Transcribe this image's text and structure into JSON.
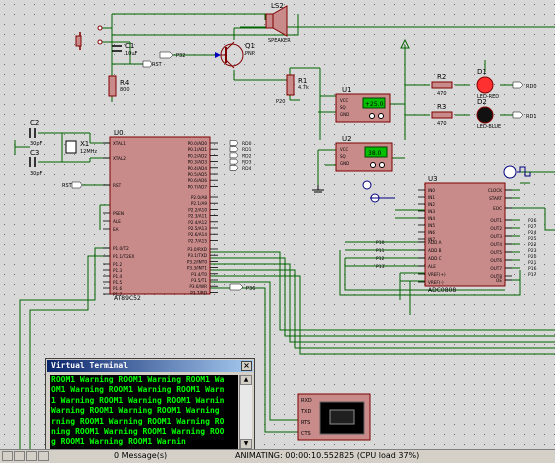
{
  "colors": {
    "background": "#d8d8d8",
    "grid_dot": "#6a6a6a",
    "wire": "#006400",
    "component_fill": "#c98a8a",
    "component_stroke": "#800000",
    "label": "#000080",
    "terminal_text": "#00ff00",
    "led_red": "#ff3030",
    "display_green": "#00c000"
  },
  "components": {
    "ls2": {
      "ref": "LS2",
      "value": "SPEAKER"
    },
    "q1": {
      "ref": "Q1",
      "value": "PNP"
    },
    "c1": {
      "ref": "C1",
      "value": "10uF"
    },
    "r4": {
      "ref": "R4",
      "value": "800"
    },
    "r1": {
      "ref": "R1",
      "value": "4.7k"
    },
    "r2": {
      "ref": "R2",
      "value": "470"
    },
    "r3": {
      "ref": "R3",
      "value": "470"
    },
    "d1": {
      "ref": "D1",
      "value": "LED-RED"
    },
    "d2": {
      "ref": "D2",
      "value": "LED-BLUE"
    },
    "c2": {
      "ref": "C2",
      "value": "30pF"
    },
    "c3": {
      "ref": "C3",
      "value": "30pF"
    },
    "x1": {
      "ref": "X1",
      "value": "12MHz"
    },
    "u0": {
      "ref": "U0",
      "value": "AT89C52"
    },
    "u1": {
      "ref": "U1",
      "value": "DHT11",
      "display": "+25.0"
    },
    "u2": {
      "ref": "U2",
      "value": "DHT11",
      "display": "38.0"
    },
    "u3": {
      "ref": "U3",
      "value": "ADC0808"
    }
  },
  "u0_pins_left": [
    "XTAL1",
    "XTAL2",
    "RST",
    "PSEN",
    "ALE",
    "EA",
    "P1.0/T2",
    "P1.1/T2EX",
    "P1.2",
    "P1.3",
    "P1.4",
    "P1.5",
    "P1.6",
    "P1.7"
  ],
  "u0_pins_right_top": [
    "P0.0/AD0",
    "P0.1/AD1",
    "P0.2/AD2",
    "P0.3/AD3",
    "P0.4/AD4",
    "P0.5/AD5",
    "P0.6/AD6",
    "P0.7/AD7"
  ],
  "u0_pins_right_mid": [
    "P2.0/A8",
    "P2.1/A9",
    "P2.2/A10",
    "P2.3/A11",
    "P2.4/A12",
    "P2.5/A13",
    "P2.6/A14",
    "P2.7/A15"
  ],
  "u0_pins_right_bot": [
    "P3.0/RXD",
    "P3.1/TXD",
    "P3.2/INT0",
    "P3.3/INT1",
    "P3.4/T0",
    "P3.5/T1",
    "P3.6/WR",
    "P3.7/RD"
  ],
  "u0_port_labels": [
    "RD0",
    "RD1",
    "RD2",
    "RD3",
    "RD4"
  ],
  "u3_pins_left": [
    "IN0",
    "IN1",
    "IN2",
    "IN3",
    "IN4",
    "IN5",
    "IN6",
    "IN7",
    "ADD A",
    "ADD B",
    "ADD C",
    "ALE",
    "VREF(+)",
    "VREF(-)"
  ],
  "u3_pins_right": [
    "CLOCK",
    "START",
    "EOC",
    "OUT1",
    "OUT2",
    "OUT3",
    "OUT4",
    "OUT5",
    "OUT6",
    "OUT7",
    "OUT8",
    "OE"
  ],
  "net_labels": {
    "p32": "P32",
    "p20": "P20",
    "p01": "P01",
    "rst": "RST",
    "p36": "P36",
    "p10": "P10",
    "p11": "P11",
    "p12": "P12",
    "p13": "P13",
    "p14": "P14",
    "p15": "P15",
    "p16": "P16",
    "p17": "P17",
    "p2x": [
      "P26",
      "P27",
      "P24",
      "P25",
      "P22",
      "P23",
      "P20",
      "P21",
      "P16",
      "P17"
    ]
  },
  "virtual_terminal": {
    "title": "Virtual Terminal",
    "lines": [
      "ROOM1 Warning ROOM1 Warning ROOM1 Wa",
      "OM1 Warning ROOM1 Warning ROOM1 Warn",
      "1 Warning ROOM1 Warning ROOM1 Warnin",
      "Warning ROOM1 Warning ROOM1 Warning",
      "rning ROOM1 Warning ROOM1 Warning RO",
      "ning ROOM1 Warning ROOM1 Warning ROO",
      "g ROOM1 Warning ROOM1 Warnin"
    ]
  },
  "terminal_pins": [
    "RXD",
    "TXD",
    "RTS",
    "CTS"
  ],
  "statusbar": {
    "messages": "0 Message(s)",
    "simulation": "ANIMATING: 00:00:10.552825 (CPU load 37%)"
  }
}
